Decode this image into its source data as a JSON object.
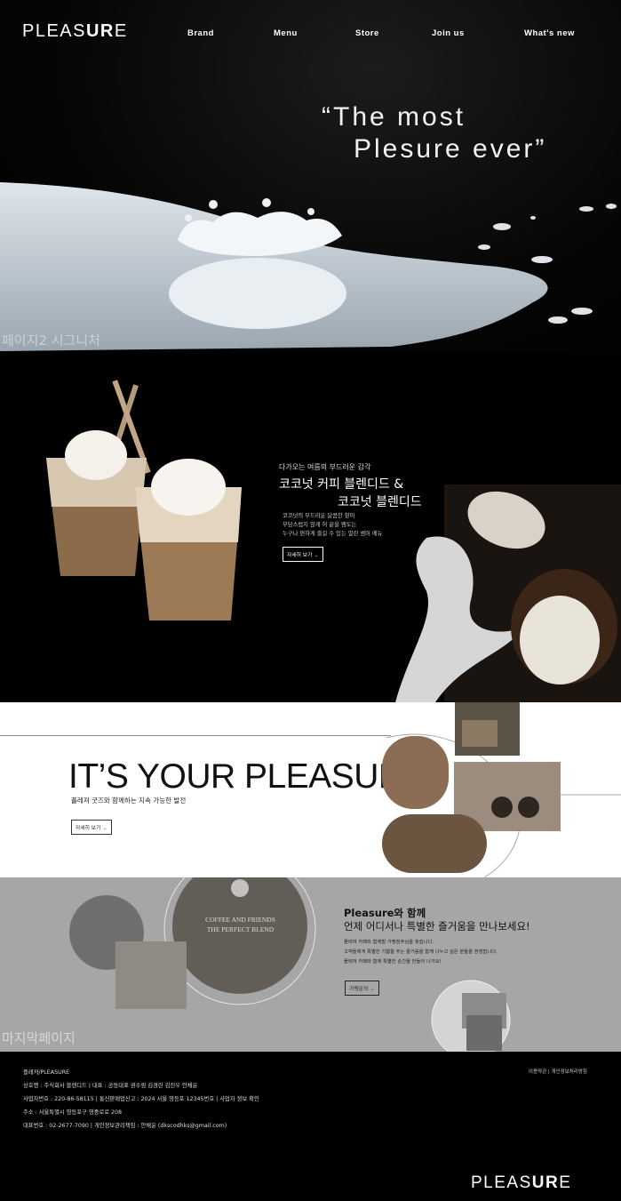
{
  "header": {
    "logo_light": "PLEAS",
    "logo_bold": "UR",
    "logo_end": "E",
    "nav": [
      "Brand",
      "Menu",
      "Store",
      "Join us",
      "What's new"
    ]
  },
  "hero": {
    "quote_line1": "“The most",
    "quote_line2": "Plesure ever”",
    "page_label": "페이지2 시그니처"
  },
  "signature": {
    "kicker": "다가오는 여름의 부드러운 감각",
    "title_line1": "코코넛 커피 블렌디드 &",
    "title_line2": "코코넛 블렌디드",
    "desc": [
      "코코넛의 부드러운 달콤한 향이",
      "부담스럽지 않게 허 끝을 맴도는",
      "누구나 편하게 즐길 수 있는 얼린 썸머 메뉴"
    ],
    "button": "자세히 보기 →"
  },
  "your_pleasure": {
    "title": "IT’S YOUR PLEASURE",
    "subtitle": "플레져 굿즈와 함께하는 지속 가능한 발전",
    "button": "자세히 보기 →"
  },
  "last": {
    "sign_line1": "COFFEE AND FRIENDS",
    "sign_line2": "THE PERFECT BLEND",
    "heading1": "Pleasure와 함께",
    "heading2": "언제 어디서나 특별한 즐거움을 만나보세요!",
    "body": [
      "플레져 카페와 함께할 가맹점주님을 찾습니다.",
      "고객들에게 특별한 기쁨을 주는 즐거움을 함께 나누고 싶은 분들을 환영합니다.",
      "플레져 카페와 함께 특별한 순간을 만들어 나가요!"
    ],
    "button": "가맹문의 →",
    "page_label": "마지막페이지"
  },
  "footer": {
    "lines": [
      "플레져/PLEASURE",
      "상호명 : 주식회사 블렌디드  |  대표 : 공동대표 권수림 김경린 김진우 안채윤",
      "사업자번호 : 220-86-58115  |  통신판매업신고 : 2024 서울 영등포 12345번호  |  사업자 정보 확인",
      "주소 : 서울특별시 영등포구 영중로로 208",
      "대표번호 : 02-2677-7090  |  개인정보관리책임 : 안채윤 (dkscodhks@gmail.com)"
    ],
    "links": "이용약관  |  개인정보처리방침",
    "logo_light": "PLEAS",
    "logo_bold": "UR",
    "logo_end": "E"
  }
}
